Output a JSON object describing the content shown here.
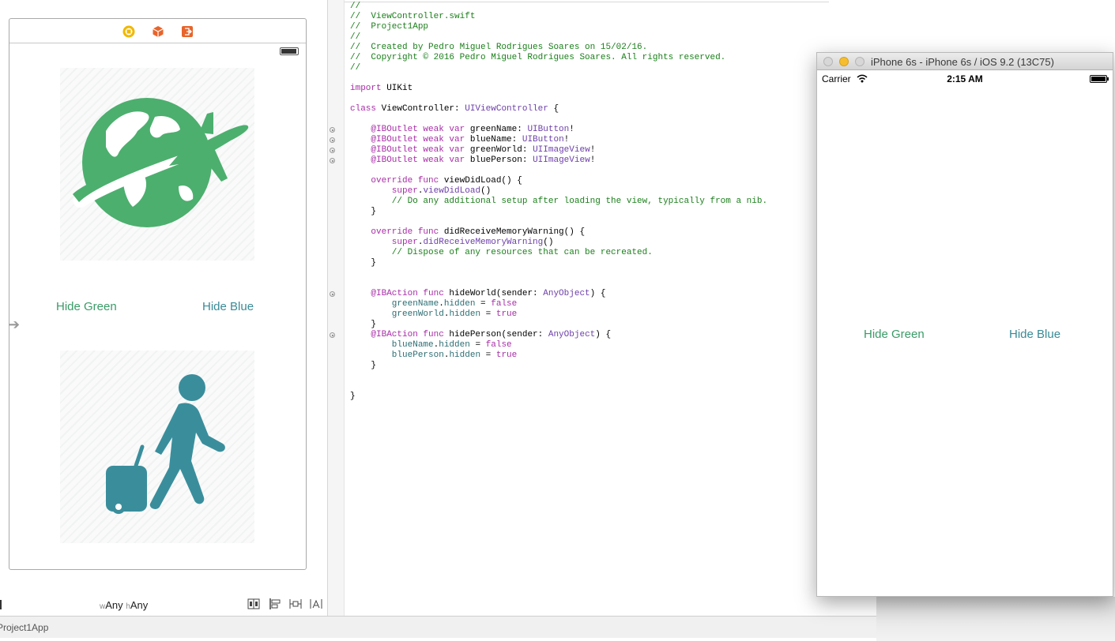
{
  "storyboard": {
    "hide_green_label": "Hide Green",
    "hide_blue_label": "Hide Blue",
    "size_class": {
      "w_prefix": "w",
      "w_value": "Any",
      "h_prefix": "h",
      "h_value": "Any"
    },
    "world_icon_color": "#4caf6e",
    "person_icon_color": "#3a8e9c",
    "dock_icons": [
      "view-controller-icon",
      "first-responder-icon",
      "exit-icon"
    ],
    "layout_tools": [
      "stack-icon",
      "align-icon",
      "pin-icon",
      "resolve-icon"
    ]
  },
  "editor": {
    "lines": [
      [
        {
          "t": "//",
          "c": "comment"
        }
      ],
      [
        {
          "t": "//  ViewController.swift",
          "c": "comment"
        }
      ],
      [
        {
          "t": "//  Project1App",
          "c": "comment"
        }
      ],
      [
        {
          "t": "//",
          "c": "comment"
        }
      ],
      [
        {
          "t": "//  Created by Pedro Miguel Rodrigues Soares on 15/02/16.",
          "c": "comment"
        }
      ],
      [
        {
          "t": "//  Copyright © 2016 Pedro Miguel Rodrigues Soares. All rights reserved.",
          "c": "comment"
        }
      ],
      [
        {
          "t": "//",
          "c": "comment"
        }
      ],
      [],
      [
        {
          "t": "import",
          "c": "keyword"
        },
        {
          "t": " UIKit",
          "c": "plain"
        }
      ],
      [],
      [
        {
          "t": "class",
          "c": "keyword"
        },
        {
          "t": " ViewController: ",
          "c": "plain"
        },
        {
          "t": "UIViewController",
          "c": "type"
        },
        {
          "t": " {",
          "c": "plain"
        }
      ],
      [],
      [
        {
          "t": "    @IBOutlet weak var",
          "c": "keyword"
        },
        {
          "t": " greenName: ",
          "c": "plain"
        },
        {
          "t": "UIButton",
          "c": "type"
        },
        {
          "t": "!",
          "c": "plain"
        }
      ],
      [
        {
          "t": "    @IBOutlet weak var",
          "c": "keyword"
        },
        {
          "t": " blueName: ",
          "c": "plain"
        },
        {
          "t": "UIButton",
          "c": "type"
        },
        {
          "t": "!",
          "c": "plain"
        }
      ],
      [
        {
          "t": "    @IBOutlet weak var",
          "c": "keyword"
        },
        {
          "t": " greenWorld: ",
          "c": "plain"
        },
        {
          "t": "UIImageView",
          "c": "type"
        },
        {
          "t": "!",
          "c": "plain"
        }
      ],
      [
        {
          "t": "    @IBOutlet weak var",
          "c": "keyword"
        },
        {
          "t": " bluePerson: ",
          "c": "plain"
        },
        {
          "t": "UIImageView",
          "c": "type"
        },
        {
          "t": "!",
          "c": "plain"
        }
      ],
      [],
      [
        {
          "t": "    override func",
          "c": "keyword"
        },
        {
          "t": " viewDidLoad() {",
          "c": "plain"
        }
      ],
      [
        {
          "t": "        super",
          "c": "keyword"
        },
        {
          "t": ".",
          "c": "plain"
        },
        {
          "t": "viewDidLoad",
          "c": "type"
        },
        {
          "t": "()",
          "c": "plain"
        }
      ],
      [
        {
          "t": "        // Do any additional setup after loading the view, typically from a nib.",
          "c": "comment"
        }
      ],
      [
        {
          "t": "    }",
          "c": "plain"
        }
      ],
      [],
      [
        {
          "t": "    override func",
          "c": "keyword"
        },
        {
          "t": " didReceiveMemoryWarning() {",
          "c": "plain"
        }
      ],
      [
        {
          "t": "        super",
          "c": "keyword"
        },
        {
          "t": ".",
          "c": "plain"
        },
        {
          "t": "didReceiveMemoryWarning",
          "c": "type"
        },
        {
          "t": "()",
          "c": "plain"
        }
      ],
      [
        {
          "t": "        // Dispose of any resources that can be recreated.",
          "c": "comment"
        }
      ],
      [
        {
          "t": "    }",
          "c": "plain"
        }
      ],
      [],
      [],
      [
        {
          "t": "    @IBAction func",
          "c": "keyword"
        },
        {
          "t": " hideWorld(sender: ",
          "c": "plain"
        },
        {
          "t": "AnyObject",
          "c": "type"
        },
        {
          "t": ") {",
          "c": "plain"
        }
      ],
      [
        {
          "t": "        greenName",
          "c": "ident"
        },
        {
          "t": ".",
          "c": "plain"
        },
        {
          "t": "hidden",
          "c": "ident"
        },
        {
          "t": " = ",
          "c": "plain"
        },
        {
          "t": "false",
          "c": "keyword"
        }
      ],
      [
        {
          "t": "        greenWorld",
          "c": "ident"
        },
        {
          "t": ".",
          "c": "plain"
        },
        {
          "t": "hidden",
          "c": "ident"
        },
        {
          "t": " = ",
          "c": "plain"
        },
        {
          "t": "true",
          "c": "keyword"
        }
      ],
      [
        {
          "t": "    }",
          "c": "plain"
        }
      ],
      [
        {
          "t": "    @IBAction func",
          "c": "keyword"
        },
        {
          "t": " hidePerson(sender: ",
          "c": "plain"
        },
        {
          "t": "AnyObject",
          "c": "type"
        },
        {
          "t": ") {",
          "c": "plain"
        }
      ],
      [
        {
          "t": "        blueName",
          "c": "ident"
        },
        {
          "t": ".",
          "c": "plain"
        },
        {
          "t": "hidden",
          "c": "ident"
        },
        {
          "t": " = ",
          "c": "plain"
        },
        {
          "t": "false",
          "c": "keyword"
        }
      ],
      [
        {
          "t": "        bluePerson",
          "c": "ident"
        },
        {
          "t": ".",
          "c": "plain"
        },
        {
          "t": "hidden",
          "c": "ident"
        },
        {
          "t": " = ",
          "c": "plain"
        },
        {
          "t": "true",
          "c": "keyword"
        }
      ],
      [
        {
          "t": "    }",
          "c": "plain"
        }
      ],
      [],
      [],
      [
        {
          "t": "}",
          "c": "plain"
        }
      ]
    ],
    "connection_lines": [
      12,
      13,
      14,
      15,
      28,
      32
    ]
  },
  "status_bar": {
    "text": "Project1App"
  },
  "simulator": {
    "title": "iPhone 6s - iPhone 6s / iOS 9.2 (13C75)",
    "carrier": "Carrier",
    "time": "2:15 AM",
    "hide_green_label": "Hide Green",
    "hide_blue_label": "Hide Blue"
  }
}
